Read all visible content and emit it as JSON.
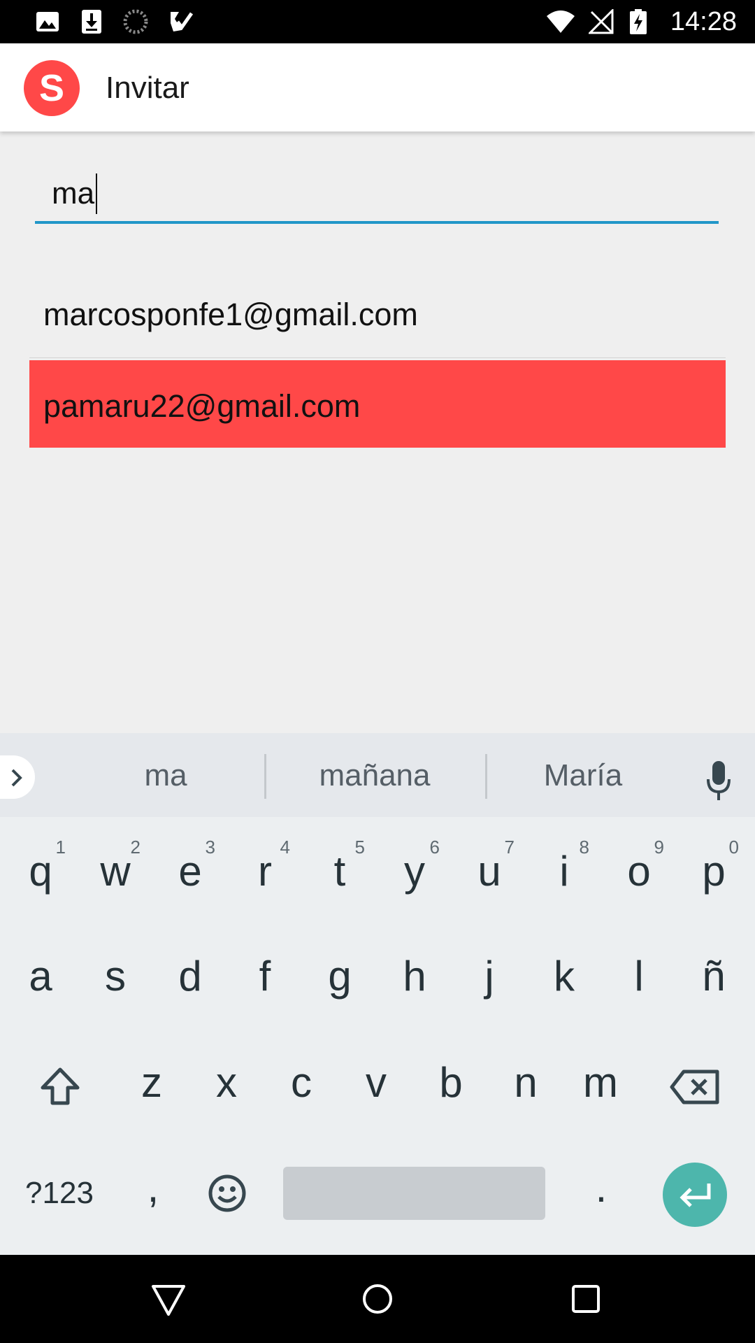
{
  "status_bar": {
    "time": "14:28",
    "left_icons": [
      "image-icon",
      "download-icon",
      "loading-icon",
      "checklist-icon"
    ],
    "right_icons": [
      "wifi-icon",
      "no-signal-icon",
      "battery-charging-icon"
    ]
  },
  "app_bar": {
    "logo_letter": "S",
    "title": "Invitar",
    "logo_color": "#ff4848"
  },
  "search": {
    "value": "ma",
    "underline_color": "#2196c8"
  },
  "results": [
    {
      "email": "marcosponfe1@gmail.com",
      "highlighted": false
    },
    {
      "email": "pamaru22@gmail.com",
      "highlighted": true,
      "highlight_color": "#ff4848"
    }
  ],
  "keyboard": {
    "suggestions": [
      "ma",
      "mañana",
      "María"
    ],
    "row1": [
      {
        "label": "q",
        "hint": "1"
      },
      {
        "label": "w",
        "hint": "2"
      },
      {
        "label": "e",
        "hint": "3"
      },
      {
        "label": "r",
        "hint": "4"
      },
      {
        "label": "t",
        "hint": "5"
      },
      {
        "label": "y",
        "hint": "6"
      },
      {
        "label": "u",
        "hint": "7"
      },
      {
        "label": "i",
        "hint": "8"
      },
      {
        "label": "o",
        "hint": "9"
      },
      {
        "label": "p",
        "hint": "0"
      }
    ],
    "row2": [
      "a",
      "s",
      "d",
      "f",
      "g",
      "h",
      "j",
      "k",
      "l",
      "ñ"
    ],
    "row3": [
      "z",
      "x",
      "c",
      "v",
      "b",
      "n",
      "m"
    ],
    "symbols_label": "?123",
    "comma_label": ",",
    "period_label": ".",
    "enter_color": "#4db6ac"
  },
  "nav_bar": {
    "buttons": [
      "back-icon",
      "home-icon",
      "recents-icon"
    ]
  }
}
